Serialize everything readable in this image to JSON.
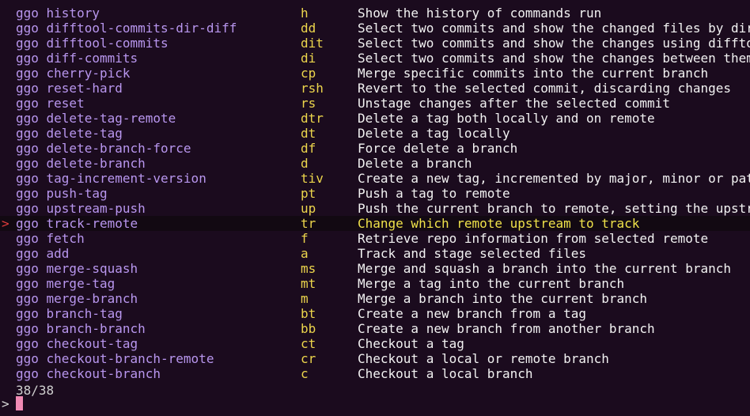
{
  "prefix": "ggo",
  "pointer_glyph": ">",
  "prompt_glyph": ">",
  "counter": "38/38",
  "selected_index": 14,
  "colors": {
    "background": "#1b0b1e",
    "command": "#b896ee",
    "alias": "#ecd54c",
    "description": "#f2f2f2",
    "selected_description": "#efe24a",
    "pointer": "#e03c3c",
    "cursor": "#f08ab4"
  },
  "rows": [
    {
      "command": "ggo history",
      "alias": "h",
      "description": "Show the history of commands run"
    },
    {
      "command": "ggo difftool-commits-dir-diff",
      "alias": "dd",
      "description": "Select two commits and show the changed files by dir.."
    },
    {
      "command": "ggo difftool-commits",
      "alias": "dit",
      "description": "Select two commits and show the changes using difftool"
    },
    {
      "command": "ggo diff-commits",
      "alias": "di",
      "description": "Select two commits and show the changes between them"
    },
    {
      "command": "ggo cherry-pick",
      "alias": "cp",
      "description": "Merge specific commits into the current branch"
    },
    {
      "command": "ggo reset-hard",
      "alias": "rsh",
      "description": "Revert to the selected commit, discarding changes"
    },
    {
      "command": "ggo reset",
      "alias": "rs",
      "description": "Unstage changes after the selected commit"
    },
    {
      "command": "ggo delete-tag-remote",
      "alias": "dtr",
      "description": "Delete a tag both locally and on remote"
    },
    {
      "command": "ggo delete-tag",
      "alias": "dt",
      "description": "Delete a tag locally"
    },
    {
      "command": "ggo delete-branch-force",
      "alias": "df",
      "description": "Force delete a branch"
    },
    {
      "command": "ggo delete-branch",
      "alias": "d",
      "description": "Delete a branch"
    },
    {
      "command": "ggo tag-increment-version",
      "alias": "tiv",
      "description": "Create a new tag, incremented by major, minor or patch"
    },
    {
      "command": "ggo push-tag",
      "alias": "pt",
      "description": "Push a tag to remote"
    },
    {
      "command": "ggo upstream-push",
      "alias": "up",
      "description": "Push the current branch to remote, setting the upstr.."
    },
    {
      "command": "ggo track-remote",
      "alias": "tr",
      "description": "Change which remote upstream to track"
    },
    {
      "command": "ggo fetch",
      "alias": "f",
      "description": "Retrieve repo information from selected remote"
    },
    {
      "command": "ggo add",
      "alias": "a",
      "description": "Track and stage selected files"
    },
    {
      "command": "ggo merge-squash",
      "alias": "ms",
      "description": "Merge and squash a branch into the current branch"
    },
    {
      "command": "ggo merge-tag",
      "alias": "mt",
      "description": "Merge a tag into the current branch"
    },
    {
      "command": "ggo merge-branch",
      "alias": "m",
      "description": "Merge a branch into the current branch"
    },
    {
      "command": "ggo branch-tag",
      "alias": "bt",
      "description": "Create a new branch from a tag"
    },
    {
      "command": "ggo branch-branch",
      "alias": "bb",
      "description": "Create a new branch from another branch"
    },
    {
      "command": "ggo checkout-tag",
      "alias": "ct",
      "description": "Checkout a tag"
    },
    {
      "command": "ggo checkout-branch-remote",
      "alias": "cr",
      "description": "Checkout a local or remote branch"
    },
    {
      "command": "ggo checkout-branch",
      "alias": "c",
      "description": "Checkout a local branch"
    }
  ]
}
